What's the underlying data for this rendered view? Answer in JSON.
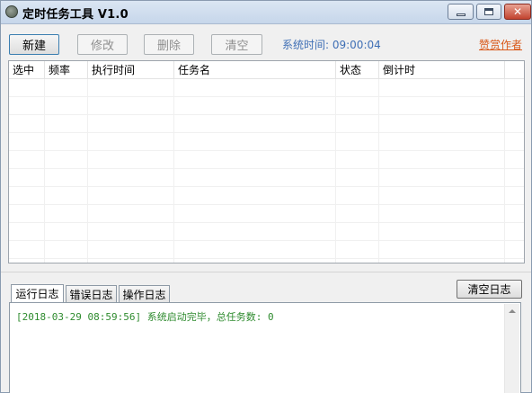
{
  "window": {
    "title": "定时任务工具 V1.0"
  },
  "toolbar": {
    "new_label": "新建",
    "edit_label": "修改",
    "delete_label": "删除",
    "clear_label": "清空",
    "system_time": "系统时间: 09:00:04",
    "donate_label": "赞赏作者"
  },
  "task_table": {
    "columns": [
      "选中",
      "频率",
      "执行时间",
      "任务名",
      "状态",
      "倒计时"
    ],
    "rows": []
  },
  "log": {
    "tabs": [
      "运行日志",
      "错误日志",
      "操作日志"
    ],
    "active_tab": "运行日志",
    "clear_label": "清空日志",
    "lines": [
      "[2018-03-29 08:59:56] 系统启动完毕，总任务数: 0"
    ]
  },
  "colors": {
    "log_text": "#2e8b2e",
    "system_time": "#3f6fb5",
    "donate_link": "#d9591a"
  }
}
